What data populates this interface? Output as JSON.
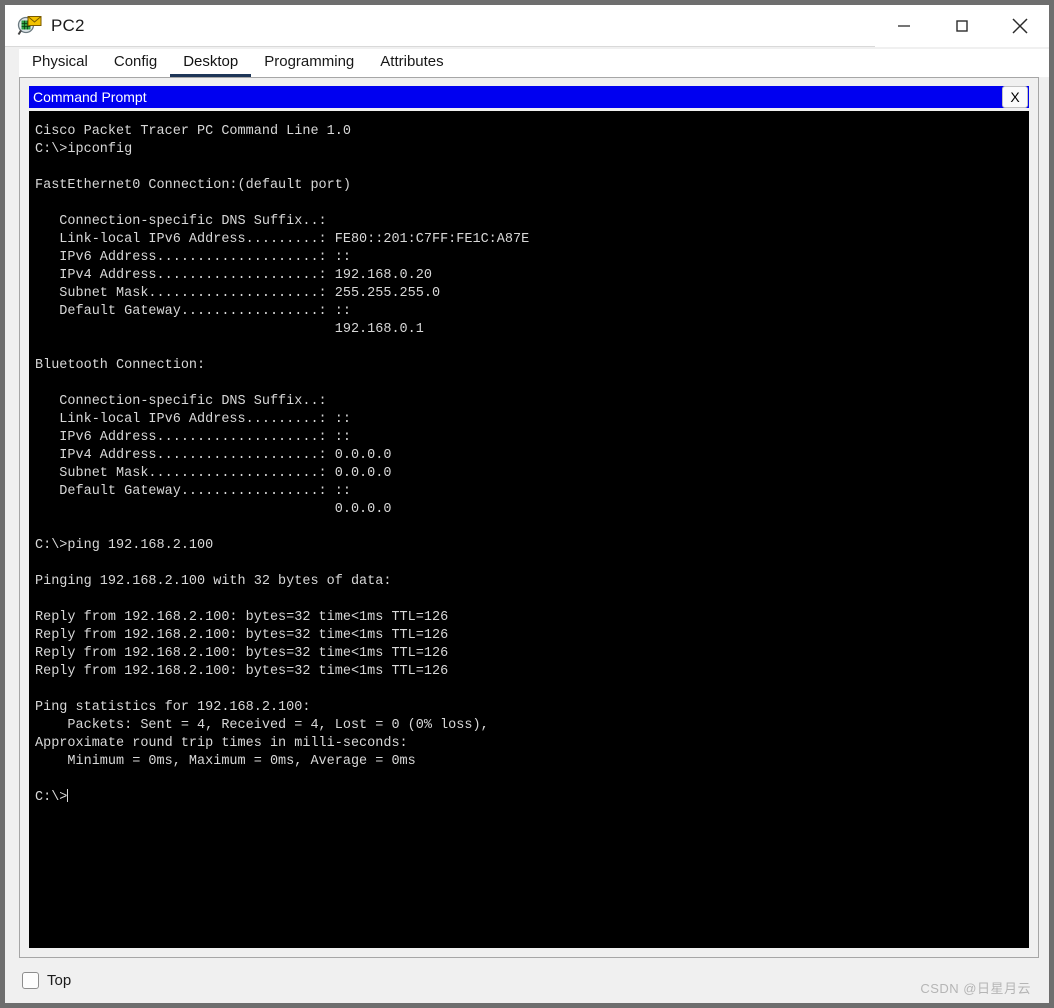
{
  "window": {
    "title": "PC2",
    "icon": "packet-tracer-device-icon",
    "controls": {
      "minimize": "minimize-icon",
      "maximize": "maximize-icon",
      "close": "close-icon"
    }
  },
  "tabs": [
    {
      "label": "Physical",
      "active": false
    },
    {
      "label": "Config",
      "active": false
    },
    {
      "label": "Desktop",
      "active": true
    },
    {
      "label": "Programming",
      "active": false
    },
    {
      "label": "Attributes",
      "active": false
    }
  ],
  "cmd_window": {
    "title": "Command Prompt",
    "close_label": "X",
    "title_bg": "#0000f0",
    "title_fg": "#ffffff"
  },
  "terminal": {
    "background": "#000000",
    "foreground": "#d8d8d8",
    "lines": [
      "Cisco Packet Tracer PC Command Line 1.0",
      "C:\\>ipconfig",
      "",
      "FastEthernet0 Connection:(default port)",
      "",
      "   Connection-specific DNS Suffix..:",
      "   Link-local IPv6 Address.........: FE80::201:C7FF:FE1C:A87E",
      "   IPv6 Address....................: ::",
      "   IPv4 Address....................: 192.168.0.20",
      "   Subnet Mask.....................: 255.255.255.0",
      "   Default Gateway.................: ::",
      "                                     192.168.0.1",
      "",
      "Bluetooth Connection:",
      "",
      "   Connection-specific DNS Suffix..:",
      "   Link-local IPv6 Address.........: ::",
      "   IPv6 Address....................: ::",
      "   IPv4 Address....................: 0.0.0.0",
      "   Subnet Mask.....................: 0.0.0.0",
      "   Default Gateway.................: ::",
      "                                     0.0.0.0",
      "",
      "C:\\>ping 192.168.2.100",
      "",
      "Pinging 192.168.2.100 with 32 bytes of data:",
      "",
      "Reply from 192.168.2.100: bytes=32 time<1ms TTL=126",
      "Reply from 192.168.2.100: bytes=32 time<1ms TTL=126",
      "Reply from 192.168.2.100: bytes=32 time<1ms TTL=126",
      "Reply from 192.168.2.100: bytes=32 time<1ms TTL=126",
      "",
      "Ping statistics for 192.168.2.100:",
      "    Packets: Sent = 4, Received = 4, Lost = 0 (0% loss),",
      "Approximate round trip times in milli-seconds:",
      "    Minimum = 0ms, Maximum = 0ms, Average = 0ms",
      "",
      "C:\\>"
    ]
  },
  "footer": {
    "top_checkbox_label": "Top",
    "top_checkbox_checked": false,
    "watermark": "CSDN @日星月云"
  }
}
